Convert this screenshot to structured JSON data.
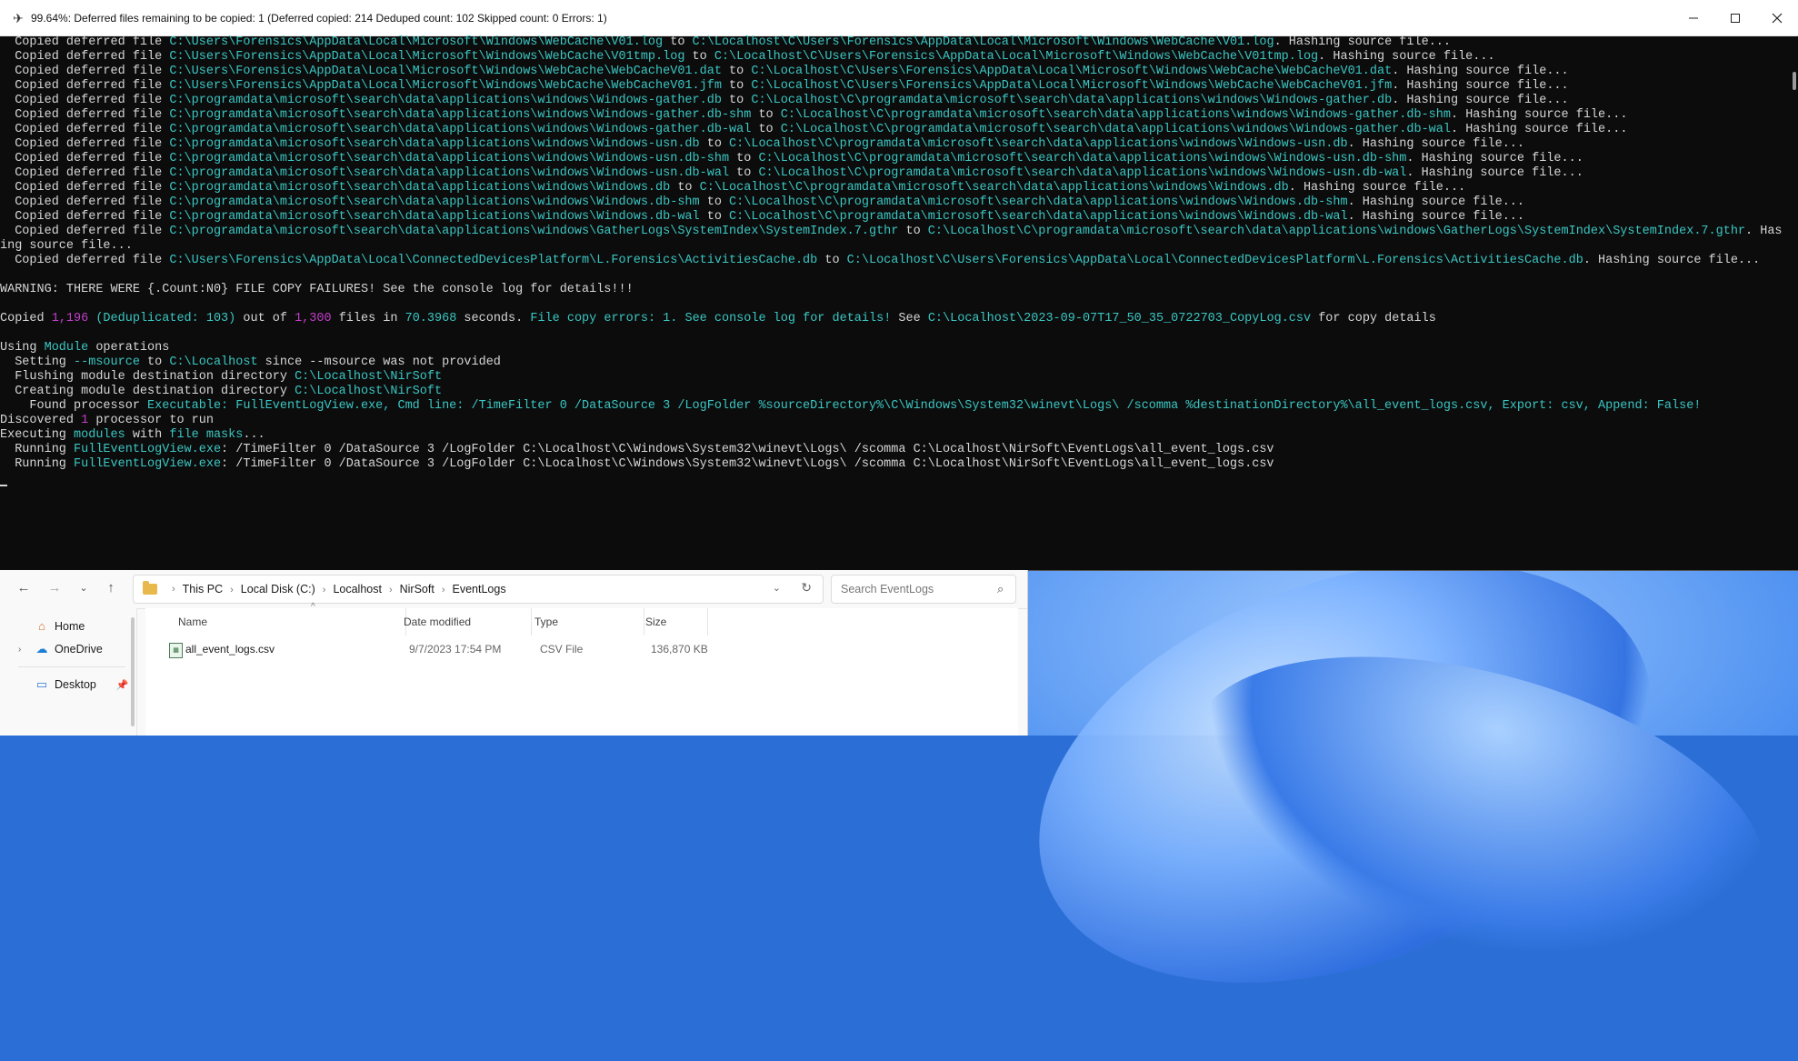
{
  "terminal": {
    "title": "99.64%: Deferred files remaining to be copied: 1 (Deferred copied: 214 Deduped count: 102 Skipped count: 0 Errors: 1)",
    "lines": [
      [
        [
          "t",
          "  Copied deferred file "
        ],
        [
          "c",
          "C:\\Users\\Forensics\\AppData\\Local\\Microsoft\\Windows\\WebCache\\V01.log"
        ],
        [
          "t",
          " to "
        ],
        [
          "c",
          "C:\\Localhost\\C\\Users\\Forensics\\AppData\\Local\\Microsoft\\Windows\\WebCache\\V01.log"
        ],
        [
          "t",
          ". Hashing source file..."
        ]
      ],
      [
        [
          "t",
          "  Copied deferred file "
        ],
        [
          "c",
          "C:\\Users\\Forensics\\AppData\\Local\\Microsoft\\Windows\\WebCache\\V01tmp.log"
        ],
        [
          "t",
          " to "
        ],
        [
          "c",
          "C:\\Localhost\\C\\Users\\Forensics\\AppData\\Local\\Microsoft\\Windows\\WebCache\\V01tmp.log"
        ],
        [
          "t",
          ". Hashing source file..."
        ]
      ],
      [
        [
          "t",
          "  Copied deferred file "
        ],
        [
          "c",
          "C:\\Users\\Forensics\\AppData\\Local\\Microsoft\\Windows\\WebCache\\WebCacheV01.dat"
        ],
        [
          "t",
          " to "
        ],
        [
          "c",
          "C:\\Localhost\\C\\Users\\Forensics\\AppData\\Local\\Microsoft\\Windows\\WebCache\\WebCacheV01.dat"
        ],
        [
          "t",
          ". Hashing source file..."
        ]
      ],
      [
        [
          "t",
          "  Copied deferred file "
        ],
        [
          "c",
          "C:\\Users\\Forensics\\AppData\\Local\\Microsoft\\Windows\\WebCache\\WebCacheV01.jfm"
        ],
        [
          "t",
          " to "
        ],
        [
          "c",
          "C:\\Localhost\\C\\Users\\Forensics\\AppData\\Local\\Microsoft\\Windows\\WebCache\\WebCacheV01.jfm"
        ],
        [
          "t",
          ". Hashing source file..."
        ]
      ],
      [
        [
          "t",
          "  Copied deferred file "
        ],
        [
          "c",
          "C:\\programdata\\microsoft\\search\\data\\applications\\windows\\Windows-gather.db"
        ],
        [
          "t",
          " to "
        ],
        [
          "c",
          "C:\\Localhost\\C\\programdata\\microsoft\\search\\data\\applications\\windows\\Windows-gather.db"
        ],
        [
          "t",
          ". Hashing source file..."
        ]
      ],
      [
        [
          "t",
          "  Copied deferred file "
        ],
        [
          "c",
          "C:\\programdata\\microsoft\\search\\data\\applications\\windows\\Windows-gather.db-shm"
        ],
        [
          "t",
          " to "
        ],
        [
          "c",
          "C:\\Localhost\\C\\programdata\\microsoft\\search\\data\\applications\\windows\\Windows-gather.db-shm"
        ],
        [
          "t",
          ". Hashing source file..."
        ]
      ],
      [
        [
          "t",
          "  Copied deferred file "
        ],
        [
          "c",
          "C:\\programdata\\microsoft\\search\\data\\applications\\windows\\Windows-gather.db-wal"
        ],
        [
          "t",
          " to "
        ],
        [
          "c",
          "C:\\Localhost\\C\\programdata\\microsoft\\search\\data\\applications\\windows\\Windows-gather.db-wal"
        ],
        [
          "t",
          ". Hashing source file..."
        ]
      ],
      [
        [
          "t",
          "  Copied deferred file "
        ],
        [
          "c",
          "C:\\programdata\\microsoft\\search\\data\\applications\\windows\\Windows-usn.db"
        ],
        [
          "t",
          " to "
        ],
        [
          "c",
          "C:\\Localhost\\C\\programdata\\microsoft\\search\\data\\applications\\windows\\Windows-usn.db"
        ],
        [
          "t",
          ". Hashing source file..."
        ]
      ],
      [
        [
          "t",
          "  Copied deferred file "
        ],
        [
          "c",
          "C:\\programdata\\microsoft\\search\\data\\applications\\windows\\Windows-usn.db-shm"
        ],
        [
          "t",
          " to "
        ],
        [
          "c",
          "C:\\Localhost\\C\\programdata\\microsoft\\search\\data\\applications\\windows\\Windows-usn.db-shm"
        ],
        [
          "t",
          ". Hashing source file..."
        ]
      ],
      [
        [
          "t",
          "  Copied deferred file "
        ],
        [
          "c",
          "C:\\programdata\\microsoft\\search\\data\\applications\\windows\\Windows-usn.db-wal"
        ],
        [
          "t",
          " to "
        ],
        [
          "c",
          "C:\\Localhost\\C\\programdata\\microsoft\\search\\data\\applications\\windows\\Windows-usn.db-wal"
        ],
        [
          "t",
          ". Hashing source file..."
        ]
      ],
      [
        [
          "t",
          "  Copied deferred file "
        ],
        [
          "c",
          "C:\\programdata\\microsoft\\search\\data\\applications\\windows\\Windows.db"
        ],
        [
          "t",
          " to "
        ],
        [
          "c",
          "C:\\Localhost\\C\\programdata\\microsoft\\search\\data\\applications\\windows\\Windows.db"
        ],
        [
          "t",
          ". Hashing source file..."
        ]
      ],
      [
        [
          "t",
          "  Copied deferred file "
        ],
        [
          "c",
          "C:\\programdata\\microsoft\\search\\data\\applications\\windows\\Windows.db-shm"
        ],
        [
          "t",
          " to "
        ],
        [
          "c",
          "C:\\Localhost\\C\\programdata\\microsoft\\search\\data\\applications\\windows\\Windows.db-shm"
        ],
        [
          "t",
          ". Hashing source file..."
        ]
      ],
      [
        [
          "t",
          "  Copied deferred file "
        ],
        [
          "c",
          "C:\\programdata\\microsoft\\search\\data\\applications\\windows\\Windows.db-wal"
        ],
        [
          "t",
          " to "
        ],
        [
          "c",
          "C:\\Localhost\\C\\programdata\\microsoft\\search\\data\\applications\\windows\\Windows.db-wal"
        ],
        [
          "t",
          ". Hashing source file..."
        ]
      ],
      [
        [
          "t",
          "  Copied deferred file "
        ],
        [
          "c",
          "C:\\programdata\\microsoft\\search\\data\\applications\\windows\\GatherLogs\\SystemIndex\\SystemIndex.7.gthr"
        ],
        [
          "t",
          " to "
        ],
        [
          "c",
          "C:\\Localhost\\C\\programdata\\microsoft\\search\\data\\applications\\windows\\GatherLogs\\SystemIndex\\SystemIndex.7.gthr"
        ],
        [
          "t",
          ". Hash"
        ]
      ],
      [
        [
          "t",
          "ing source file..."
        ]
      ],
      [
        [
          "t",
          "  Copied deferred file "
        ],
        [
          "c",
          "C:\\Users\\Forensics\\AppData\\Local\\ConnectedDevicesPlatform\\L.Forensics\\ActivitiesCache.db"
        ],
        [
          "t",
          " to "
        ],
        [
          "c",
          "C:\\Localhost\\C\\Users\\Forensics\\AppData\\Local\\ConnectedDevicesPlatform\\L.Forensics\\ActivitiesCache.db"
        ],
        [
          "t",
          ". Hashing source file..."
        ]
      ],
      [],
      [
        [
          "t",
          "WARNING: THERE WERE {.Count:N0} FILE COPY FAILURES! See the console log for details!!!"
        ]
      ],
      [],
      [
        [
          "t",
          "Copied "
        ],
        [
          "m",
          "1,196"
        ],
        [
          "c",
          " (Deduplicated: 103)"
        ],
        [
          "t",
          " out of "
        ],
        [
          "m",
          "1,300"
        ],
        [
          "t",
          " files in "
        ],
        [
          "c",
          "70.3968"
        ],
        [
          "t",
          " seconds. "
        ],
        [
          "c",
          "File copy errors: 1. See console log for details!"
        ],
        [
          "t",
          " See "
        ],
        [
          "c",
          "C:\\Localhost\\2023-09-07T17_50_35_0722703_CopyLog.csv"
        ],
        [
          "t",
          " for copy details"
        ]
      ],
      [],
      [
        [
          "t",
          "Using "
        ],
        [
          "c",
          "Module"
        ],
        [
          "t",
          " operations"
        ]
      ],
      [
        [
          "t",
          "  Setting "
        ],
        [
          "c",
          "--msource"
        ],
        [
          "t",
          " to "
        ],
        [
          "c",
          "C:\\Localhost"
        ],
        [
          "t",
          " since --msource was not provided"
        ]
      ],
      [
        [
          "t",
          "  Flushing module destination directory "
        ],
        [
          "c",
          "C:\\Localhost\\NirSoft"
        ]
      ],
      [
        [
          "t",
          "  Creating module destination directory "
        ],
        [
          "c",
          "C:\\Localhost\\NirSoft"
        ]
      ],
      [
        [
          "t",
          "    Found processor "
        ],
        [
          "c",
          "Executable: FullEventLogView.exe, Cmd line: /TimeFilter 0 /DataSource 3 /LogFolder %sourceDirectory%\\C\\Windows\\System32\\winevt\\Logs\\ /scomma %destinationDirectory%\\all_event_logs.csv, Export: csv, Append: False!"
        ]
      ],
      [
        [
          "t",
          "Discovered "
        ],
        [
          "m",
          "1"
        ],
        [
          "t",
          " processor to run"
        ]
      ],
      [
        [
          "t",
          "Executing "
        ],
        [
          "c",
          "modules"
        ],
        [
          "t",
          " with "
        ],
        [
          "c",
          "file masks"
        ],
        [
          "t",
          "..."
        ]
      ],
      [
        [
          "t",
          "  Running "
        ],
        [
          "c",
          "FullEventLogView.exe"
        ],
        [
          "t",
          ": /TimeFilter 0 /DataSource 3 /LogFolder C:\\Localhost\\C\\Windows\\System32\\winevt\\Logs\\ /scomma C:\\Localhost\\NirSoft\\EventLogs\\all_event_logs.csv"
        ]
      ],
      [
        [
          "t",
          "  Running "
        ],
        [
          "c",
          "FullEventLogView.exe"
        ],
        [
          "t",
          ": /TimeFilter 0 /DataSource 3 /LogFolder C:\\Localhost\\C\\Windows\\System32\\winevt\\Logs\\ /scomma C:\\Localhost\\NirSoft\\EventLogs\\all_event_logs.csv"
        ]
      ]
    ]
  },
  "explorer": {
    "breadcrumb": [
      "This PC",
      "Local Disk (C:)",
      "Localhost",
      "NirSoft",
      "EventLogs"
    ],
    "search_placeholder": "Search EventLogs",
    "nav_items": [
      {
        "label": "Home",
        "icon": "home-icon",
        "expandable": false
      },
      {
        "label": "OneDrive",
        "icon": "cloud-icon",
        "expandable": true
      },
      {
        "label": "Desktop",
        "icon": "desktop-icon",
        "expandable": false,
        "pinned": true
      }
    ],
    "columns": [
      "Name",
      "Date modified",
      "Type",
      "Size"
    ],
    "files": [
      {
        "name": "all_event_logs.csv",
        "date": "9/7/2023 17:54 PM",
        "type": "CSV File",
        "size": "136,870 KB"
      }
    ]
  },
  "colors": {
    "cyan": "#3ac6c2",
    "magenta": "#c23fc9",
    "console_bg": "#0c0c0c"
  }
}
